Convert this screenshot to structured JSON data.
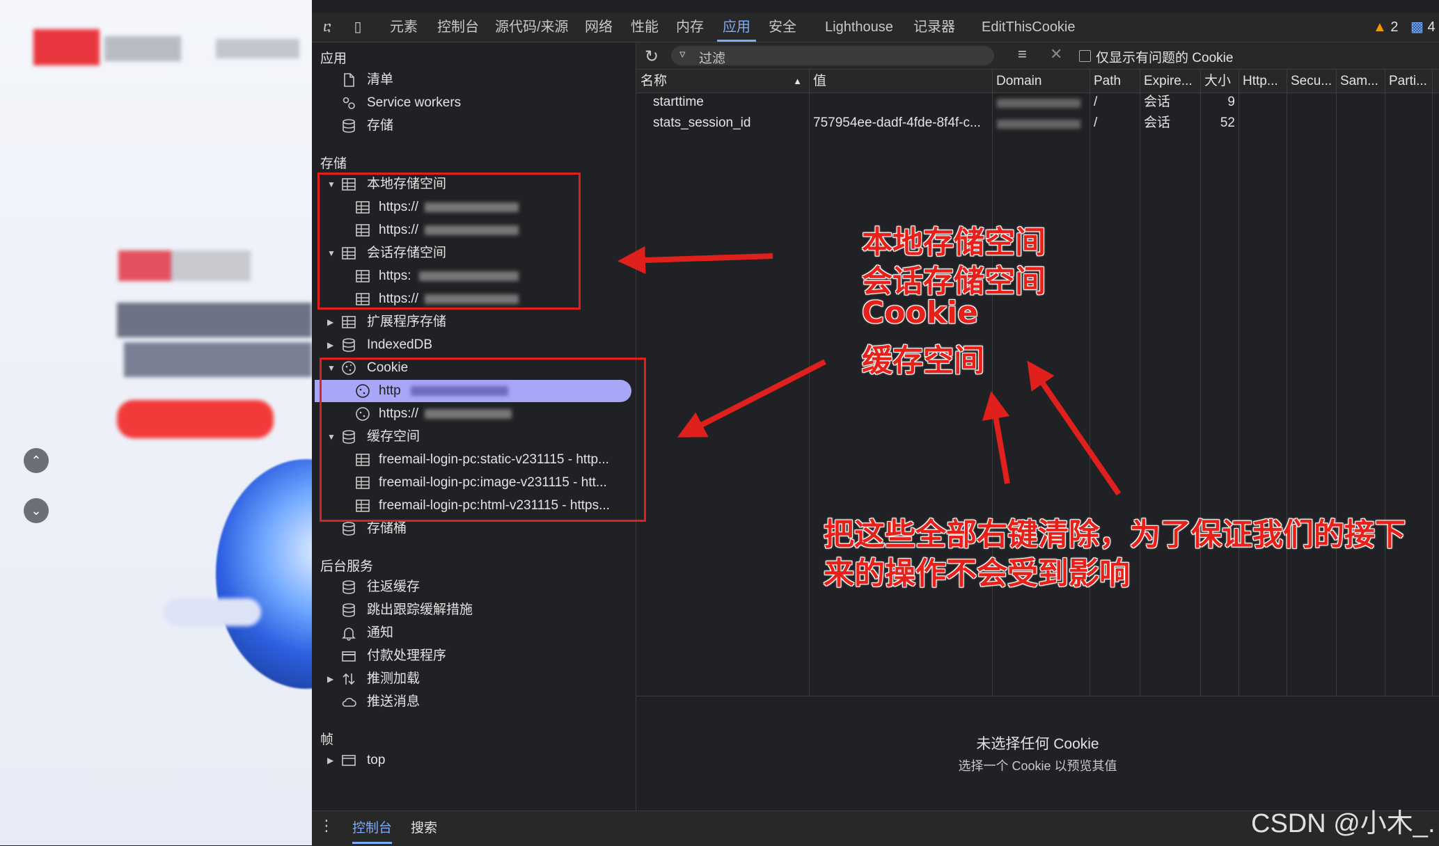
{
  "tabs": [
    "元素",
    "控制台",
    "源代码/来源",
    "网络",
    "性能",
    "内存",
    "应用",
    "安全",
    "Lighthouse",
    "记录器",
    "EditThisCookie"
  ],
  "active_tab": "应用",
  "issues": {
    "warnings": "2",
    "messages": "4"
  },
  "sidebar": {
    "application": {
      "heading": "应用",
      "items": [
        {
          "label": "清单",
          "icon": "file-icon"
        },
        {
          "label": "Service workers",
          "icon": "gears-icon"
        },
        {
          "label": "存储",
          "icon": "database-icon"
        }
      ]
    },
    "storage": {
      "heading": "存储",
      "local_storage": {
        "label": "本地存储空间",
        "children": [
          "https://",
          "https://"
        ]
      },
      "session_storage": {
        "label": "会话存储空间",
        "children": [
          "https:",
          "https://"
        ]
      },
      "extension_storage": "扩展程序存储",
      "indexeddb": "IndexedDB",
      "cookie": {
        "label": "Cookie",
        "children": [
          "http",
          "https://"
        ]
      },
      "cache": {
        "label": "缓存空间",
        "children": [
          "freemail-login-pc:static-v231115 - http...",
          "freemail-login-pc:image-v231115 - htt...",
          "freemail-login-pc:html-v231115 - https..."
        ]
      },
      "buckets": "存储桶"
    },
    "background": {
      "heading": "后台服务",
      "items": [
        {
          "label": "往返缓存",
          "icon": "database-icon"
        },
        {
          "label": "跳出跟踪缓解措施",
          "icon": "database-icon"
        },
        {
          "label": "通知",
          "icon": "bell-icon"
        },
        {
          "label": "付款处理程序",
          "icon": "card-icon"
        },
        {
          "label": "推测加载",
          "icon": "speculative-icon"
        },
        {
          "label": "推送消息",
          "icon": "cloud-icon"
        }
      ]
    },
    "frames": {
      "heading": "帧",
      "top": "top"
    }
  },
  "toolbar": {
    "filter_placeholder": "过滤",
    "only_issues_label": "仅显示有问题的 Cookie"
  },
  "table": {
    "headers": [
      "名称",
      "值",
      "Domain",
      "Path",
      "Expire...",
      "大小",
      "Http...",
      "Secu...",
      "Sam...",
      "Parti..."
    ],
    "rows": [
      {
        "name": "starttime",
        "value": "",
        "path": "/",
        "expires": "会话",
        "size": "9"
      },
      {
        "name": "stats_session_id",
        "value": "757954ee-dadf-4fde-8f4f-c...",
        "path": "/",
        "expires": "会话",
        "size": "52"
      }
    ]
  },
  "preview": {
    "title": "未选择任何 Cookie",
    "subtitle": "选择一个 Cookie 以预览其值"
  },
  "drawer": {
    "tabs": [
      "控制台",
      "搜索"
    ]
  },
  "annotations": {
    "labels": [
      "本地存储空间",
      "会话存储空间",
      "Cookie",
      "缓存空间"
    ],
    "note_line1": "把这些全部右键清除，为了保证我们的接下",
    "note_line2": "来的操作不会受到影响",
    "colors": {
      "red": "#e0201c"
    }
  },
  "watermark": "CSDN @小木_."
}
